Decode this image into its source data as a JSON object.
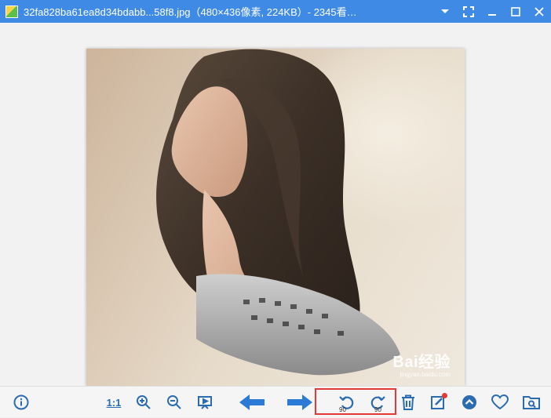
{
  "window": {
    "title": "32fa828ba61ea8d34bdabb...58f8.jpg（480×436像素, 224KB）- 2345看…"
  },
  "photo": {
    "watermark_main": "Bai经验",
    "watermark_sub": "jingyan.baidu.com"
  },
  "toolbar": {
    "actual_size_label": "1:1",
    "rotate_left_degrees": "90",
    "rotate_right_degrees": "90"
  },
  "colors": {
    "titlebar": "#3e8ae4",
    "icon_blue": "#2b6cb0",
    "highlight": "#e53935"
  },
  "icons": [
    "app-icon",
    "dropdown-icon",
    "fullscreen-icon",
    "minimize-icon",
    "maximize-icon",
    "close-icon",
    "info-icon",
    "zoom-in-icon",
    "zoom-out-icon",
    "slideshow-icon",
    "arrow-left-icon",
    "arrow-right-icon",
    "rotate-left-icon",
    "rotate-right-icon",
    "trash-icon",
    "edit-icon",
    "up-icon",
    "heart-icon",
    "folder-search-icon"
  ]
}
